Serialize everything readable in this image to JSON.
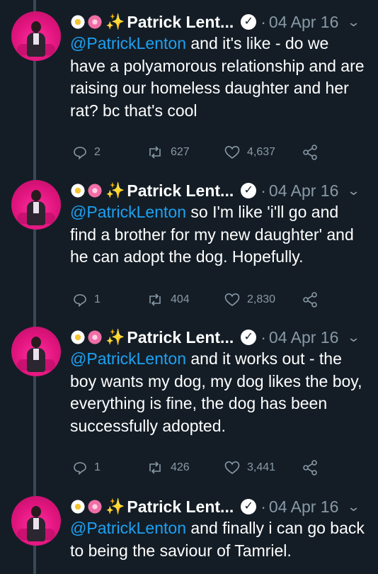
{
  "tweets": [
    {
      "author": "Patrick Lent...",
      "date": "04 Apr 16",
      "mention": "@PatrickLenton",
      "text": " and it's like - do we have a polyamorous relationship and are raising our homeless daughter and her rat? bc that's cool",
      "replies": "2",
      "retweets": "627",
      "likes": "4,637"
    },
    {
      "author": "Patrick Lent...",
      "date": "04 Apr 16",
      "mention": "@PatrickLenton",
      "text": " so I'm like 'i'll go and find a brother for my new daughter' and he can adopt the dog. Hopefully.",
      "replies": "1",
      "retweets": "404",
      "likes": "2,830"
    },
    {
      "author": "Patrick Lent...",
      "date": "04 Apr 16",
      "mention": "@PatrickLenton",
      "text": " and it works out - the boy wants my dog, my dog likes the boy, everything is fine, the dog has been successfully adopted.",
      "replies": "1",
      "retweets": "426",
      "likes": "3,441"
    },
    {
      "author": "Patrick Lent...",
      "date": "04 Apr 16",
      "mention": "@PatrickLenton",
      "text": " and finally i can go back to being the saviour of Tamriel."
    }
  ],
  "colors": {
    "background": "#141d26",
    "mention": "#1da1f2",
    "muted": "#8899a6",
    "avatar_bg": "#e0147d"
  },
  "icons": [
    "daisy-emoji",
    "cherry-blossom-emoji",
    "sparkles-emoji",
    "verified-badge-icon",
    "chevron-down-icon",
    "reply-icon",
    "retweet-icon",
    "like-icon",
    "share-icon"
  ]
}
